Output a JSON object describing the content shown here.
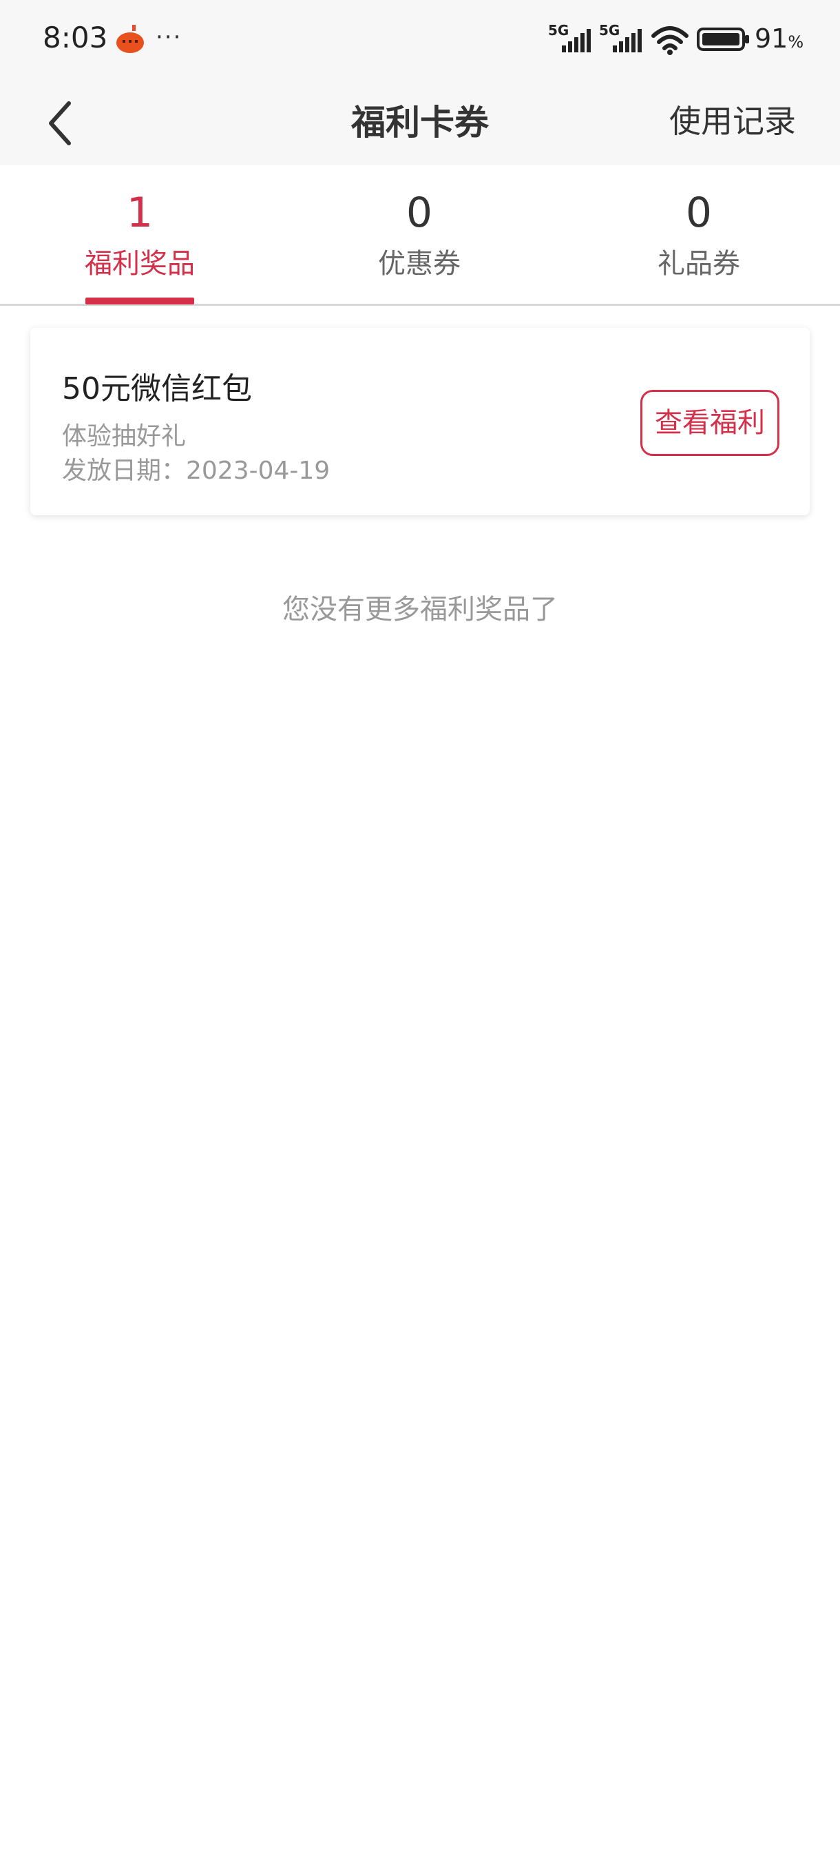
{
  "status_bar": {
    "time": "8:03",
    "more_dots": "···",
    "network_1": "5G",
    "network_2": "5G",
    "battery_percent": "91",
    "battery_unit": "%"
  },
  "nav": {
    "title": "福利卡券",
    "usage_record": "使用记录"
  },
  "tabs": [
    {
      "count": "1",
      "label": "福利奖品"
    },
    {
      "count": "0",
      "label": "优惠券"
    },
    {
      "count": "0",
      "label": "礼品券"
    }
  ],
  "card": {
    "title": "50元微信红包",
    "source": "体验抽好礼",
    "date": "发放日期：2023-04-19",
    "button_label": "查看福利"
  },
  "empty_note": "您没有更多福利奖品了",
  "colors": {
    "accent": "#d4304a",
    "bar_bg": "#f7f7f7"
  }
}
